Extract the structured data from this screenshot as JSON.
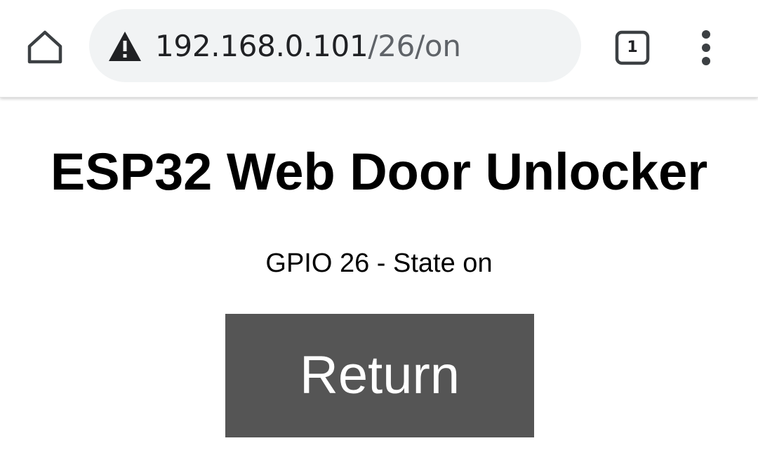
{
  "browser": {
    "url_host": "192.168.0.101",
    "url_path": "/26/on",
    "tab_count": "1",
    "security_icon": "warning-icon",
    "home_icon": "home-icon",
    "menu_icon": "more-vert-icon"
  },
  "page": {
    "title": "ESP32 Web Door Unlocker",
    "status": "GPIO 26 - State on",
    "return_button": "Return"
  },
  "colors": {
    "button_bg": "#555555",
    "button_text": "#ffffff",
    "omnibox_bg": "#f1f3f4"
  }
}
